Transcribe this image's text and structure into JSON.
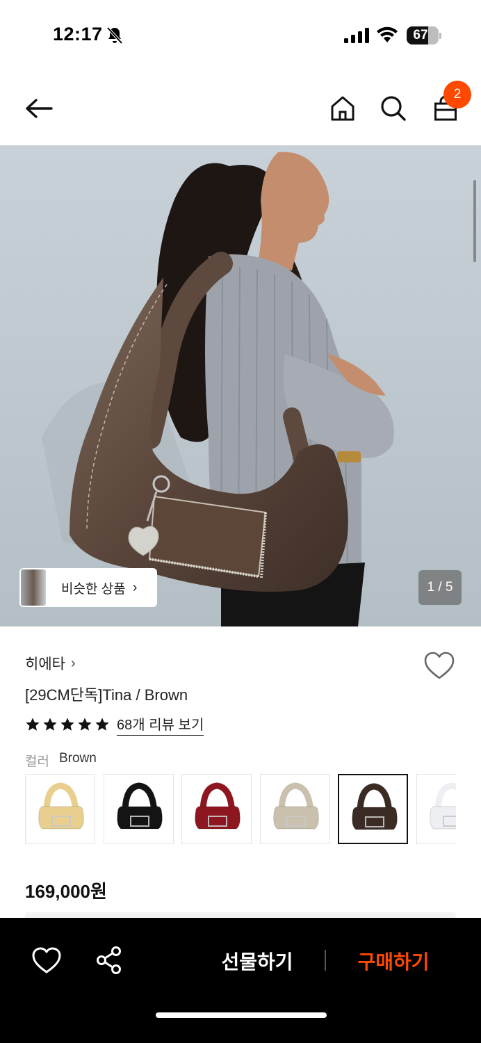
{
  "status_bar": {
    "time": "12:17",
    "battery": "67",
    "battery_level": 0.67
  },
  "header": {
    "cart_count": "2"
  },
  "gallery": {
    "similar_label": "비슷한 상품",
    "counter": "1 / 5"
  },
  "product": {
    "brand": "히에타",
    "title": "[29CM단독]Tina / Brown",
    "rating_stars": 5,
    "review_link": "68개 리뷰 보기",
    "color_label": "컬러",
    "color_value": "Brown",
    "price": "169,000원"
  },
  "swatches": [
    {
      "name": "yellow",
      "color": "#e8cf8e",
      "selected": false
    },
    {
      "name": "black",
      "color": "#141414",
      "selected": false
    },
    {
      "name": "red",
      "color": "#8e1620",
      "selected": false
    },
    {
      "name": "silver-beige",
      "color": "#c9c1ae",
      "selected": false
    },
    {
      "name": "brown",
      "color": "#3a2b24",
      "selected": true
    },
    {
      "name": "white",
      "color": "#eeeff2",
      "selected": false
    }
  ],
  "bottom_bar": {
    "gift_label": "선물하기",
    "buy_label": "구매하기"
  },
  "colors": {
    "accent": "#ff4800",
    "bottom_bar_bg": "#000000"
  }
}
